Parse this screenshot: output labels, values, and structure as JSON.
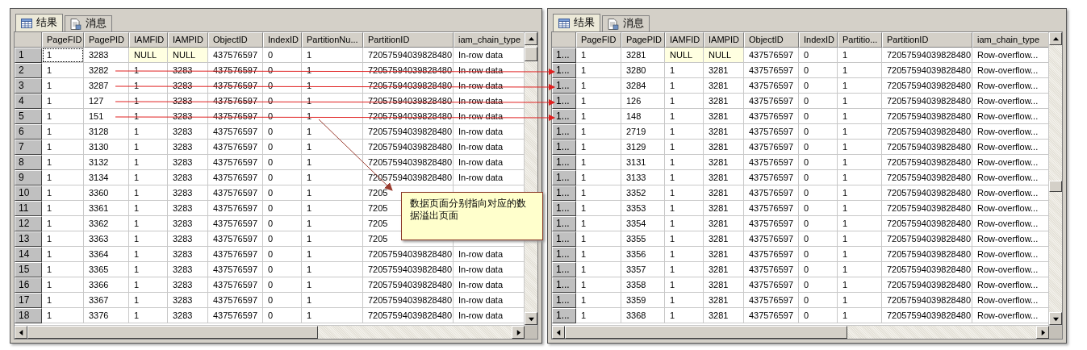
{
  "panels": [
    {
      "tabs": [
        {
          "label": "结果",
          "kind": "grid",
          "selected": true
        },
        {
          "label": "消息",
          "kind": "messages",
          "selected": false
        }
      ],
      "columns": [
        "PageFID",
        "PagePID",
        "IAMFID",
        "IAMPID",
        "ObjectID",
        "IndexID",
        "PartitionNu...",
        "PartitionID",
        "iam_chain_type"
      ],
      "rows": [
        {
          "header": "1",
          "cells": [
            {
              "text": "1",
              "focused": true
            },
            "3283",
            {
              "text": "NULL",
              "is_null": true
            },
            {
              "text": "NULL",
              "is_null": true
            },
            "437576597",
            "0",
            "1",
            "72057594039828480",
            "In-row data"
          ]
        },
        {
          "header": "2",
          "cells": [
            "1",
            "3282",
            "1",
            "3283",
            "437576597",
            "0",
            "1",
            "72057594039828480",
            "In-row data"
          ]
        },
        {
          "header": "3",
          "cells": [
            "1",
            "3287",
            "1",
            "3283",
            "437576597",
            "0",
            "1",
            "72057594039828480",
            "In-row data"
          ]
        },
        {
          "header": "4",
          "cells": [
            "1",
            "127",
            "1",
            "3283",
            "437576597",
            "0",
            "1",
            "72057594039828480",
            "In-row data"
          ]
        },
        {
          "header": "5",
          "cells": [
            "1",
            "151",
            "1",
            "3283",
            "437576597",
            "0",
            "1",
            "72057594039828480",
            "In-row data"
          ]
        },
        {
          "header": "6",
          "cells": [
            "1",
            "3128",
            "1",
            "3283",
            "437576597",
            "0",
            "1",
            "72057594039828480",
            "In-row data"
          ]
        },
        {
          "header": "7",
          "cells": [
            "1",
            "3130",
            "1",
            "3283",
            "437576597",
            "0",
            "1",
            "72057594039828480",
            "In-row data"
          ]
        },
        {
          "header": "8",
          "cells": [
            "1",
            "3132",
            "1",
            "3283",
            "437576597",
            "0",
            "1",
            "72057594039828480",
            "In-row data"
          ]
        },
        {
          "header": "9",
          "cells": [
            "1",
            "3134",
            "1",
            "3283",
            "437576597",
            "0",
            "1",
            "72057594039828480",
            "In-row data"
          ]
        },
        {
          "header": "10",
          "cells": [
            "1",
            "3360",
            "1",
            "3283",
            "437576597",
            "0",
            "1",
            "7205"
          ]
        },
        {
          "header": "11",
          "cells": [
            "1",
            "3361",
            "1",
            "3283",
            "437576597",
            "0",
            "1",
            "7205"
          ]
        },
        {
          "header": "12",
          "cells": [
            "1",
            "3362",
            "1",
            "3283",
            "437576597",
            "0",
            "1",
            "7205"
          ]
        },
        {
          "header": "13",
          "cells": [
            "1",
            "3363",
            "1",
            "3283",
            "437576597",
            "0",
            "1",
            "7205"
          ]
        },
        {
          "header": "14",
          "cells": [
            "1",
            "3364",
            "1",
            "3283",
            "437576597",
            "0",
            "1",
            "72057594039828480",
            "In-row data"
          ]
        },
        {
          "header": "15",
          "cells": [
            "1",
            "3365",
            "1",
            "3283",
            "437576597",
            "0",
            "1",
            "72057594039828480",
            "In-row data"
          ]
        },
        {
          "header": "16",
          "cells": [
            "1",
            "3366",
            "1",
            "3283",
            "437576597",
            "0",
            "1",
            "72057594039828480",
            "In-row data"
          ]
        },
        {
          "header": "17",
          "cells": [
            "1",
            "3367",
            "1",
            "3283",
            "437576597",
            "0",
            "1",
            "72057594039828480",
            "In-row data"
          ]
        },
        {
          "header": "18",
          "cells": [
            "1",
            "3376",
            "1",
            "3283",
            "437576597",
            "0",
            "1",
            "72057594039828480",
            "In-row data"
          ]
        }
      ]
    },
    {
      "tabs": [
        {
          "label": "结果",
          "kind": "grid",
          "selected": true
        },
        {
          "label": "消息",
          "kind": "messages",
          "selected": false
        }
      ],
      "columns": [
        "PageFID",
        "PagePID",
        "IAMFID",
        "IAMPID",
        "ObjectID",
        "IndexID",
        "Partitio...",
        "PartitionID",
        "iam_chain_type"
      ],
      "rows": [
        {
          "header": "1...",
          "cells": [
            "1",
            "3281",
            {
              "text": "NULL",
              "is_null": true
            },
            {
              "text": "NULL",
              "is_null": true
            },
            "437576597",
            "0",
            "1",
            "72057594039828480",
            "Row-overflow..."
          ]
        },
        {
          "header": "1...",
          "cells": [
            "1",
            "3280",
            "1",
            "3281",
            "437576597",
            "0",
            "1",
            "72057594039828480",
            "Row-overflow..."
          ]
        },
        {
          "header": "1...",
          "cells": [
            "1",
            "3284",
            "1",
            "3281",
            "437576597",
            "0",
            "1",
            "72057594039828480",
            "Row-overflow..."
          ]
        },
        {
          "header": "1...",
          "cells": [
            "1",
            "126",
            "1",
            "3281",
            "437576597",
            "0",
            "1",
            "72057594039828480",
            "Row-overflow..."
          ]
        },
        {
          "header": "1...",
          "cells": [
            "1",
            "148",
            "1",
            "3281",
            "437576597",
            "0",
            "1",
            "72057594039828480",
            "Row-overflow..."
          ]
        },
        {
          "header": "1...",
          "cells": [
            "1",
            "2719",
            "1",
            "3281",
            "437576597",
            "0",
            "1",
            "72057594039828480",
            "Row-overflow..."
          ]
        },
        {
          "header": "1...",
          "cells": [
            "1",
            "3129",
            "1",
            "3281",
            "437576597",
            "0",
            "1",
            "72057594039828480",
            "Row-overflow..."
          ]
        },
        {
          "header": "1...",
          "cells": [
            "1",
            "3131",
            "1",
            "3281",
            "437576597",
            "0",
            "1",
            "72057594039828480",
            "Row-overflow..."
          ]
        },
        {
          "header": "1...",
          "cells": [
            "1",
            "3133",
            "1",
            "3281",
            "437576597",
            "0",
            "1",
            "72057594039828480",
            "Row-overflow..."
          ]
        },
        {
          "header": "1...",
          "cells": [
            "1",
            "3352",
            "1",
            "3281",
            "437576597",
            "0",
            "1",
            "72057594039828480",
            "Row-overflow..."
          ]
        },
        {
          "header": "1...",
          "cells": [
            "1",
            "3353",
            "1",
            "3281",
            "437576597",
            "0",
            "1",
            "72057594039828480",
            "Row-overflow..."
          ]
        },
        {
          "header": "1...",
          "cells": [
            "1",
            "3354",
            "1",
            "3281",
            "437576597",
            "0",
            "1",
            "72057594039828480",
            "Row-overflow..."
          ]
        },
        {
          "header": "1...",
          "cells": [
            "1",
            "3355",
            "1",
            "3281",
            "437576597",
            "0",
            "1",
            "72057594039828480",
            "Row-overflow..."
          ]
        },
        {
          "header": "1...",
          "cells": [
            "1",
            "3356",
            "1",
            "3281",
            "437576597",
            "0",
            "1",
            "72057594039828480",
            "Row-overflow..."
          ]
        },
        {
          "header": "1...",
          "cells": [
            "1",
            "3357",
            "1",
            "3281",
            "437576597",
            "0",
            "1",
            "72057594039828480",
            "Row-overflow..."
          ]
        },
        {
          "header": "1...",
          "cells": [
            "1",
            "3358",
            "1",
            "3281",
            "437576597",
            "0",
            "1",
            "72057594039828480",
            "Row-overflow..."
          ]
        },
        {
          "header": "1...",
          "cells": [
            "1",
            "3359",
            "1",
            "3281",
            "437576597",
            "0",
            "1",
            "72057594039828480",
            "Row-overflow..."
          ]
        },
        {
          "header": "1...",
          "cells": [
            "1",
            "3368",
            "1",
            "3281",
            "437576597",
            "0",
            "1",
            "72057594039828480",
            "Row-overflow..."
          ]
        }
      ]
    }
  ],
  "callout": {
    "text": "数据页面分别指向对应的数据溢出页面"
  }
}
